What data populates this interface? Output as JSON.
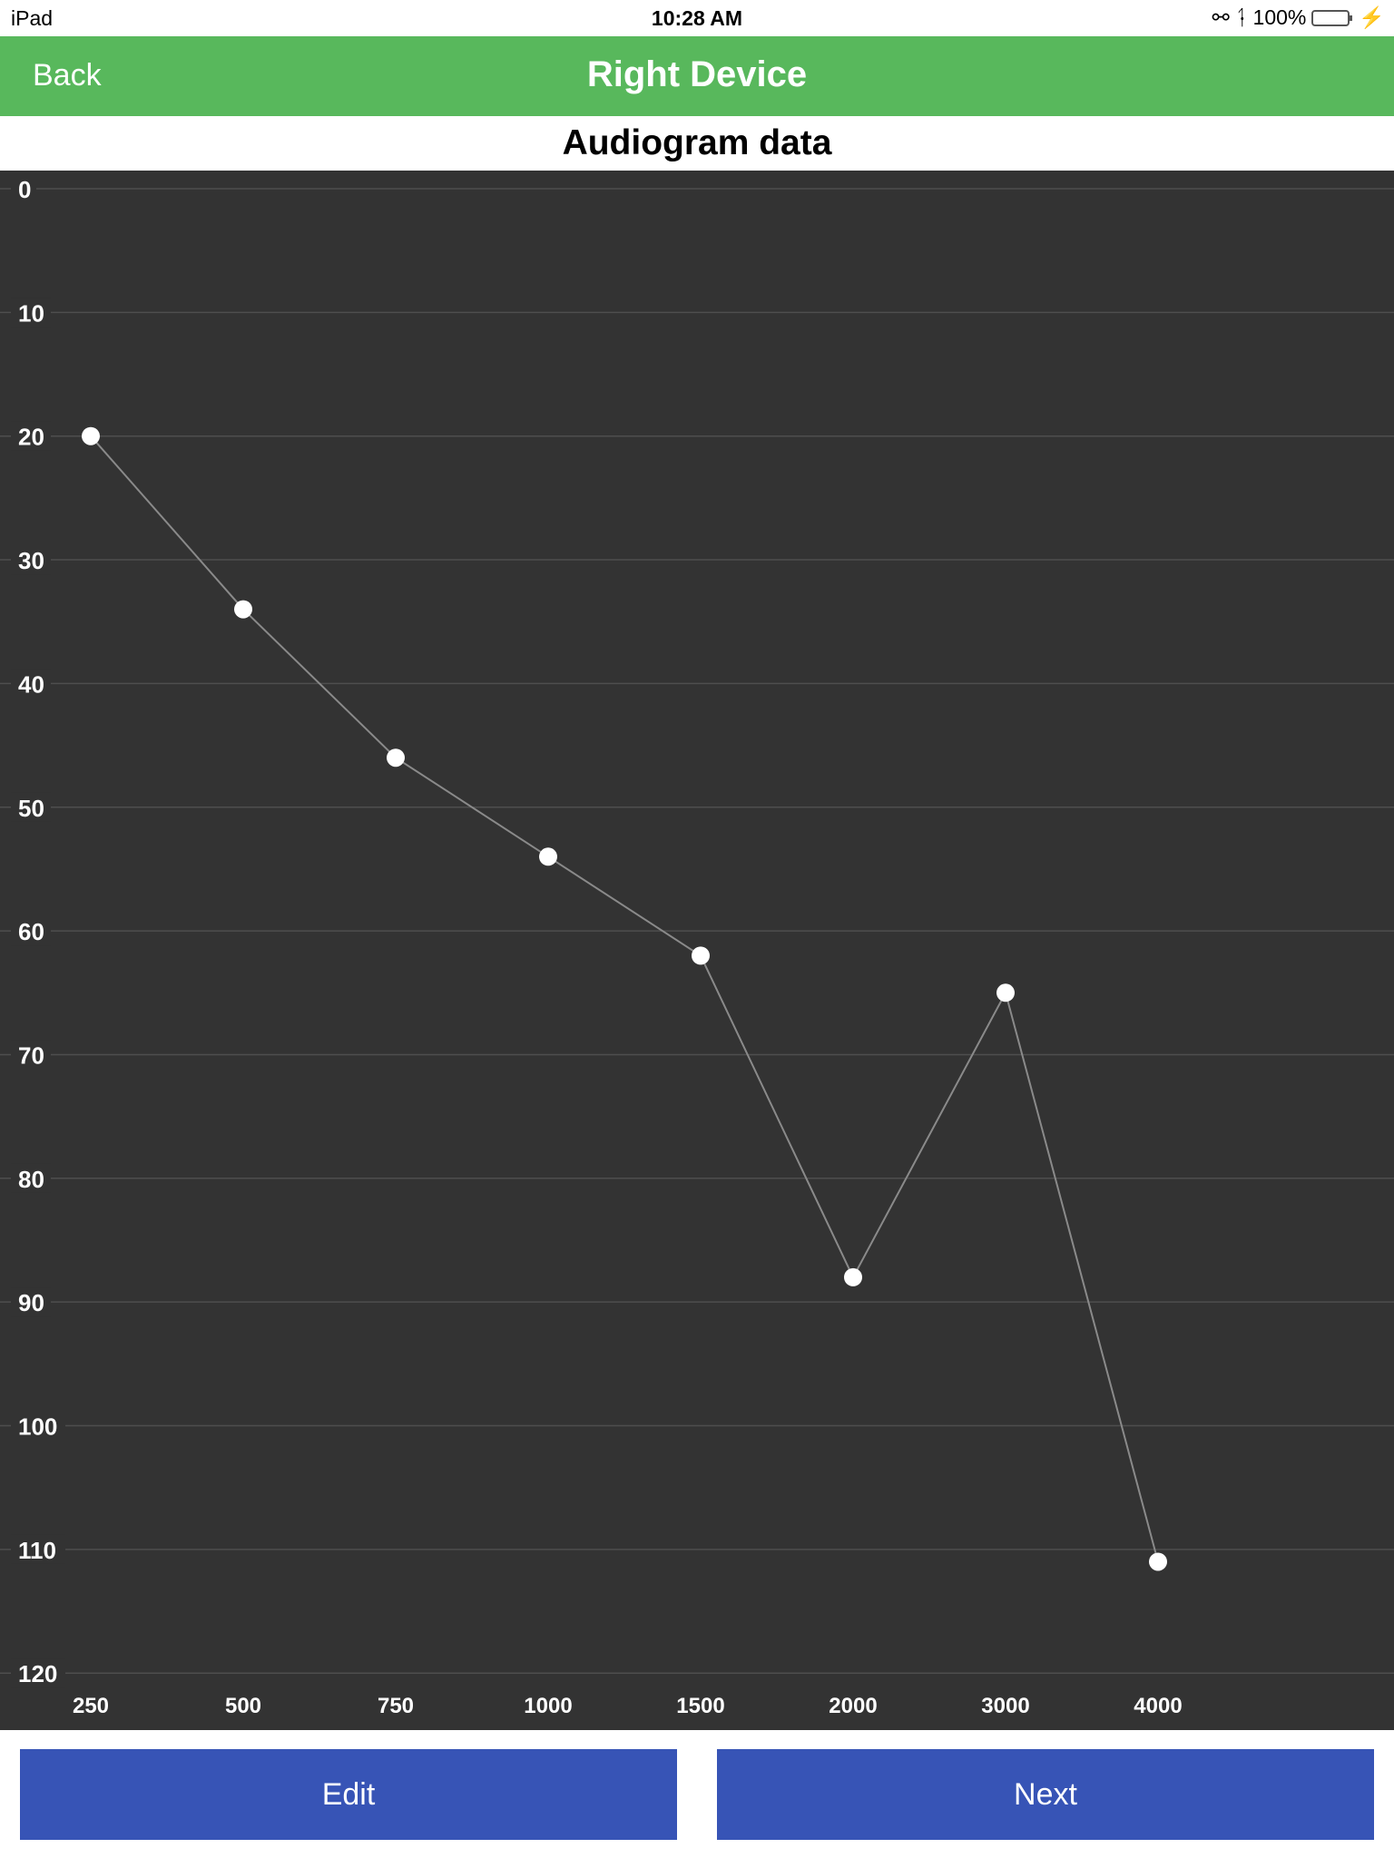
{
  "status_bar": {
    "device": "iPad",
    "time": "10:28 AM",
    "battery": "100%",
    "icons": [
      "orientation-lock-icon",
      "bluetooth-icon",
      "battery-icon",
      "charging-icon"
    ]
  },
  "nav": {
    "back_label": "Back",
    "title": "Right Device",
    "color": "#58b85c"
  },
  "subtitle": "Audiogram data",
  "chart_data": {
    "type": "line",
    "title": "",
    "xlabel": "",
    "ylabel": "",
    "categories": [
      "250",
      "500",
      "750",
      "1000",
      "1500",
      "2000",
      "3000",
      "4000"
    ],
    "values": [
      20,
      34,
      46,
      54,
      62,
      88,
      65,
      111
    ],
    "y_ticks": [
      "0",
      "10",
      "20",
      "30",
      "40",
      "50",
      "60",
      "70",
      "80",
      "90",
      "100",
      "110",
      "120"
    ],
    "ylim": [
      0,
      120
    ],
    "y_inverted": true,
    "grid": true,
    "legend": "none",
    "background": "#333333",
    "line_color": "#8a8a8a",
    "marker_color": "#ffffff"
  },
  "buttons": {
    "edit_label": "Edit",
    "next_label": "Next",
    "color": "#3754b6"
  }
}
